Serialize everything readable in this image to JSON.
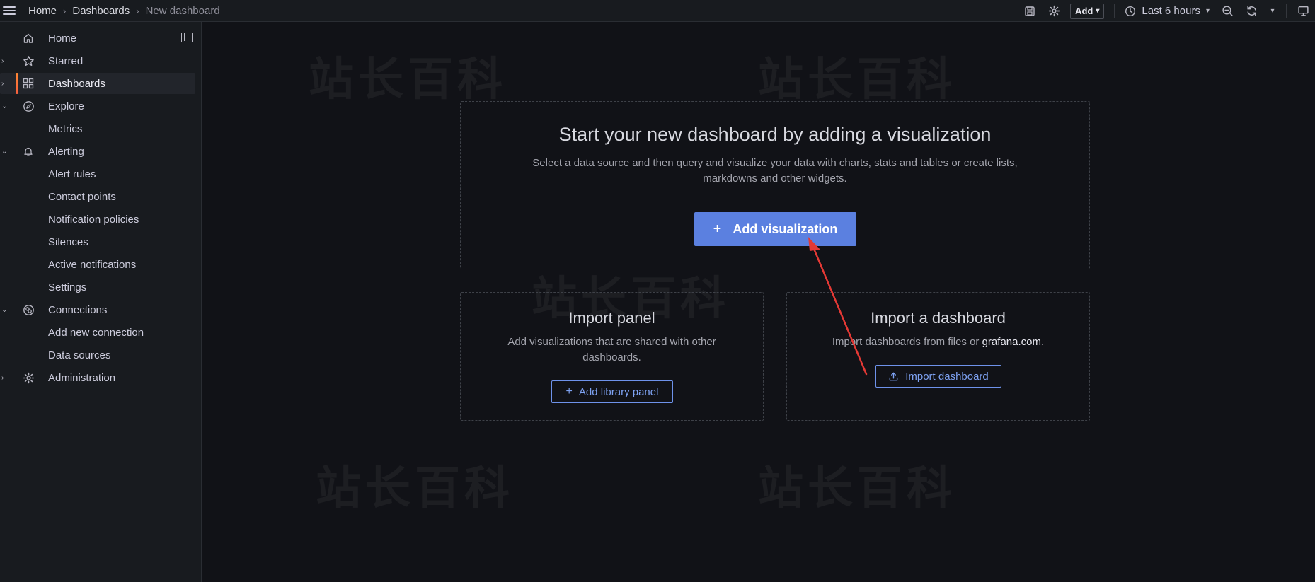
{
  "breadcrumb": [
    "Home",
    "Dashboards",
    "New dashboard"
  ],
  "toolbar": {
    "add_label": "Add",
    "time_range": "Last 6 hours"
  },
  "sidebar": {
    "items": [
      {
        "label": "Home",
        "icon": "home-icon"
      },
      {
        "label": "Starred",
        "icon": "star-icon"
      },
      {
        "label": "Dashboards",
        "icon": "apps-icon",
        "active": true
      },
      {
        "label": "Explore",
        "icon": "compass-icon"
      },
      {
        "label": "Metrics"
      },
      {
        "label": "Alerting",
        "icon": "bell-icon"
      },
      {
        "label": "Alert rules"
      },
      {
        "label": "Contact points"
      },
      {
        "label": "Notification policies"
      },
      {
        "label": "Silences"
      },
      {
        "label": "Active notifications"
      },
      {
        "label": "Settings"
      },
      {
        "label": "Connections",
        "icon": "connections-icon"
      },
      {
        "label": "Add new connection"
      },
      {
        "label": "Data sources"
      },
      {
        "label": "Administration",
        "icon": "cog-icon"
      }
    ]
  },
  "main": {
    "hero_title": "Start your new dashboard by adding a visualization",
    "hero_desc": "Select a data source and then query and visualize your data with charts, stats and tables or create lists, markdowns and other widgets.",
    "add_viz_label": "Add visualization",
    "import_panel": {
      "title": "Import panel",
      "desc": "Add visualizations that are shared with other dashboards.",
      "button": "Add library panel"
    },
    "import_dashboard": {
      "title": "Import a dashboard",
      "desc_prefix": "Import dashboards from files or ",
      "desc_link": "grafana.com",
      "desc_suffix": ".",
      "button": "Import dashboard"
    }
  },
  "watermark_text": "站长百科",
  "colors": {
    "accent": "#5b80e0",
    "active_bar": "#ff8833",
    "annotation_arrow": "#e53935"
  }
}
